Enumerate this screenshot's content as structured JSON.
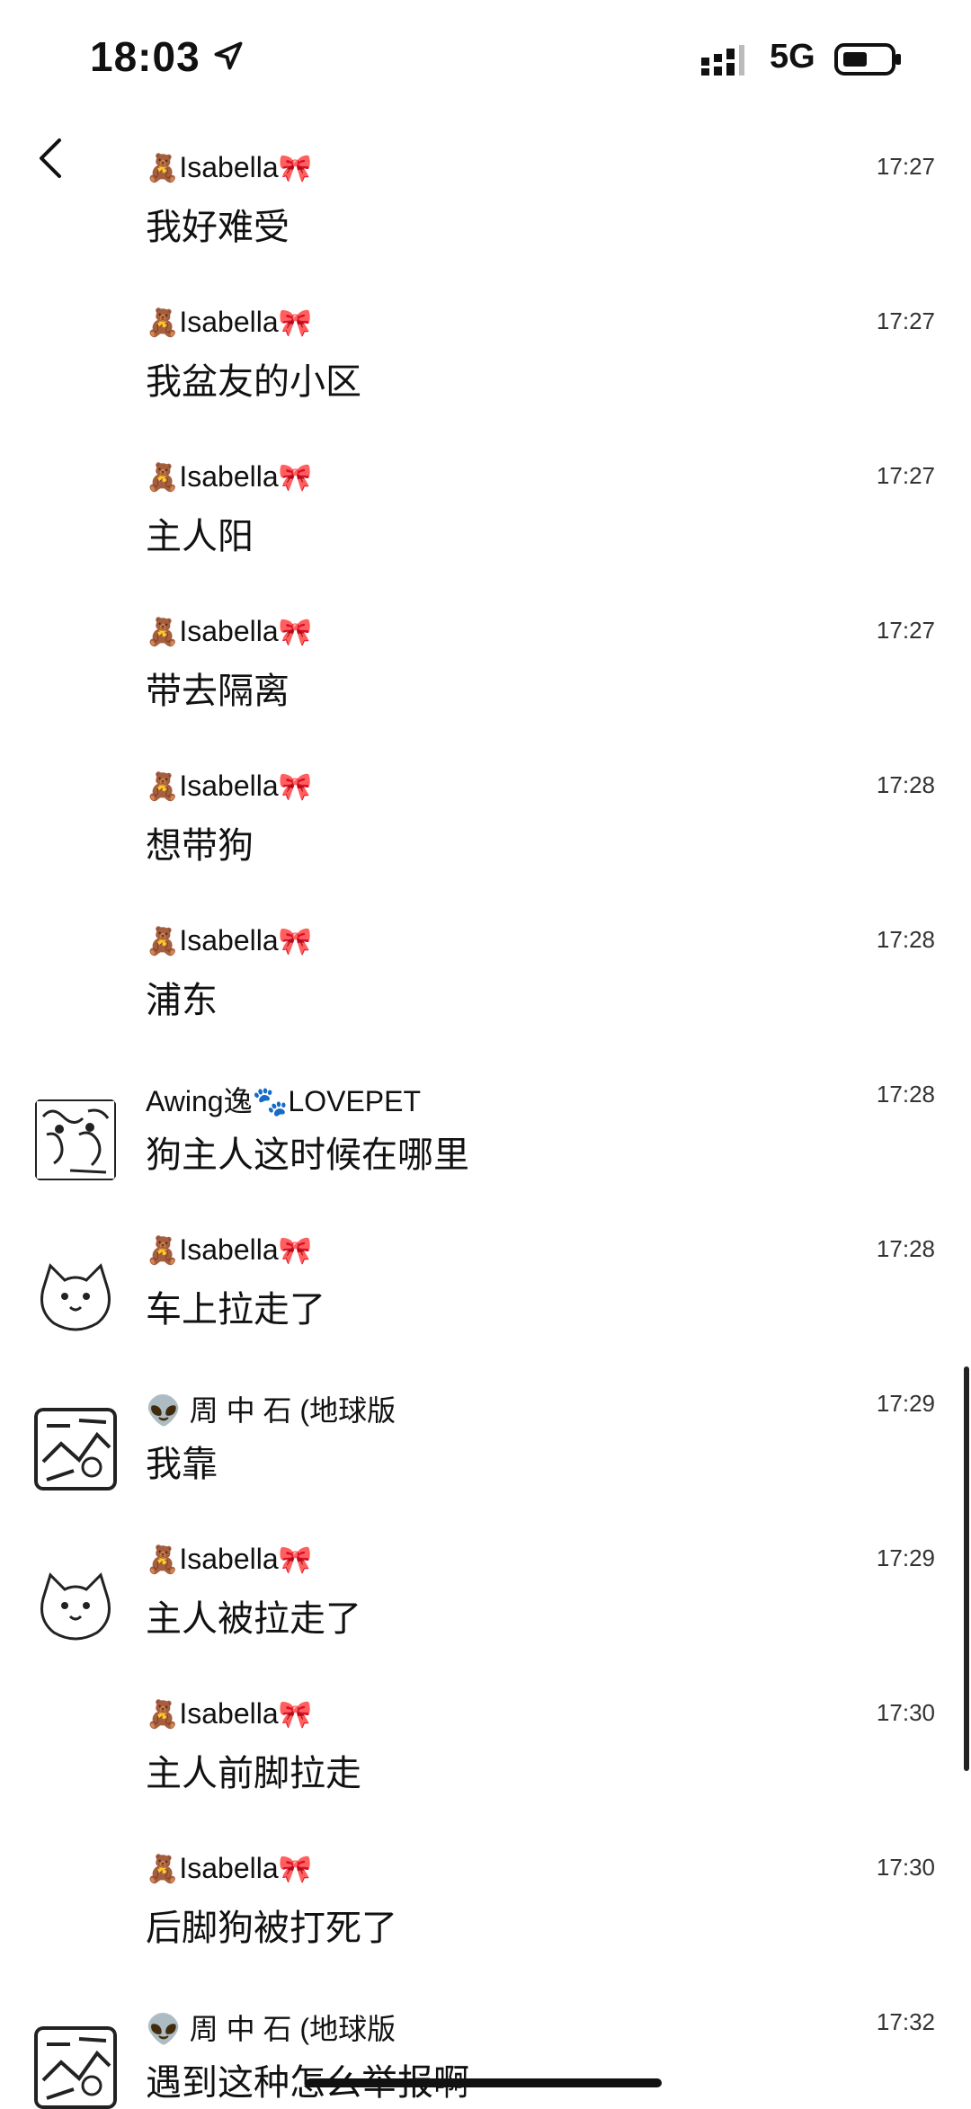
{
  "status": {
    "time": "18:03",
    "network": "5G"
  },
  "messages": [
    {
      "sender": "Isabella",
      "text": "我好难受",
      "time": "17:27",
      "avatar": "none"
    },
    {
      "sender": "Isabella",
      "text": "我盆友的小区",
      "time": "17:27",
      "avatar": "none"
    },
    {
      "sender": "Isabella",
      "text": "主人阳",
      "time": "17:27",
      "avatar": "none"
    },
    {
      "sender": "Isabella",
      "text": "带去隔离",
      "time": "17:27",
      "avatar": "none"
    },
    {
      "sender": "Isabella",
      "text": "想带狗",
      "time": "17:28",
      "avatar": "none"
    },
    {
      "sender": "Isabella",
      "text": "浦东",
      "time": "17:28",
      "avatar": "none"
    },
    {
      "sender": "Awing逸🐾LOVEPET",
      "text": "狗主人这时候在哪里",
      "time": "17:28",
      "avatar": "sketch"
    },
    {
      "sender": "Isabella",
      "text": "车上拉走了",
      "time": "17:28",
      "avatar": "cat"
    },
    {
      "sender": "👽 周 中 石 (地球版",
      "text": "我靠",
      "time": "17:29",
      "avatar": "box"
    },
    {
      "sender": "Isabella",
      "text": "主人被拉走了",
      "time": "17:29",
      "avatar": "cat"
    },
    {
      "sender": "Isabella",
      "text": "主人前脚拉走",
      "time": "17:30",
      "avatar": "none"
    },
    {
      "sender": "Isabella",
      "text": "后脚狗被打死了",
      "time": "17:30",
      "avatar": "none"
    },
    {
      "sender": "👽 周 中 石 (地球版",
      "text": "遇到这种怎么举报啊",
      "time": "17:32",
      "avatar": "box"
    }
  ]
}
